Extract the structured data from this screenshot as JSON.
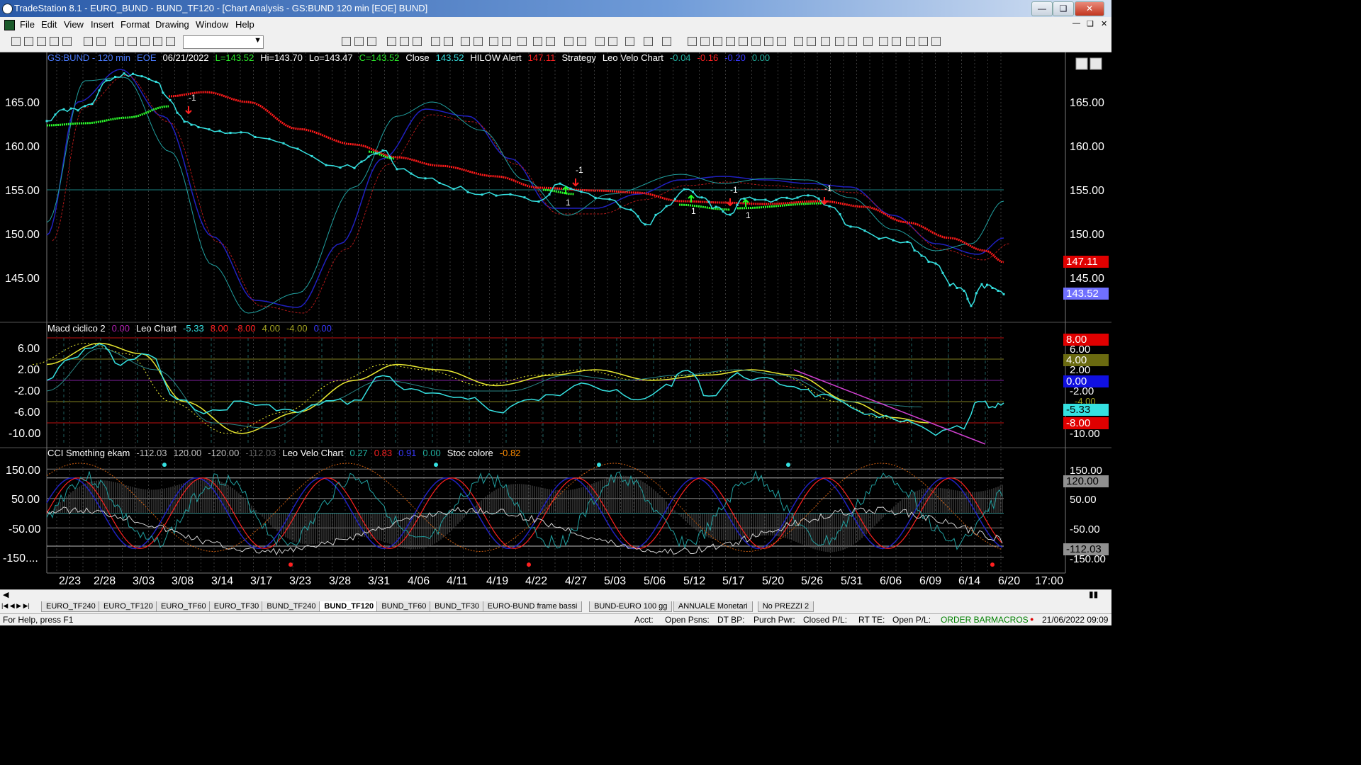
{
  "window": {
    "title": "TradeStation 8.1 - EURO_BUND - BUND_TF120 - [Chart Analysis - GS:BUND  120 min  [EOE] BUND]"
  },
  "menu": [
    "File",
    "Edit",
    "View",
    "Insert",
    "Format",
    "Drawing",
    "Window",
    "Help"
  ],
  "price_panel": {
    "header": [
      {
        "t": "GS:BUND - 120 min",
        "c": "#4a7bff"
      },
      {
        "t": "EOE",
        "c": "#4a7bff"
      },
      {
        "t": "06/21/2022",
        "c": "#ffffff"
      },
      {
        "t": "L=143.52",
        "c": "#29e629"
      },
      {
        "t": "Hi=143.70",
        "c": "#ffffff"
      },
      {
        "t": "Lo=143.47",
        "c": "#ffffff"
      },
      {
        "t": "C=143.52",
        "c": "#29e629"
      },
      {
        "t": "Close",
        "c": "#ffffff"
      },
      {
        "t": "143.52",
        "c": "#35e0e0"
      },
      {
        "t": "HILOW Alert",
        "c": "#ffffff"
      },
      {
        "t": "147.11",
        "c": "#ff2020"
      },
      {
        "t": "Strategy",
        "c": "#ffffff"
      },
      {
        "t": "Leo Velo Chart",
        "c": "#ffffff"
      },
      {
        "t": "-0.04",
        "c": "#20b0a0"
      },
      {
        "t": "-0.16",
        "c": "#ff2020"
      },
      {
        "t": "-0.20",
        "c": "#3838ff"
      },
      {
        "t": "0.00",
        "c": "#20b0a0"
      }
    ],
    "y_ticks": [
      "165.00",
      "160.00",
      "155.00",
      "150.00",
      "145.00"
    ],
    "last_red": "147.11",
    "last_close": "143.52",
    "signals": [
      "-1",
      "-1",
      "1",
      "-1",
      "1",
      "1",
      "-1"
    ]
  },
  "macd_panel": {
    "header": [
      {
        "t": "Macd ciclico 2",
        "c": "#ffffff"
      },
      {
        "t": "0.00",
        "c": "#b020b0"
      },
      {
        "t": "Leo Chart",
        "c": "#ffffff"
      },
      {
        "t": "-5.33",
        "c": "#35e0e0"
      },
      {
        "t": "8.00",
        "c": "#ff2020"
      },
      {
        "t": "-8.00",
        "c": "#ff2020"
      },
      {
        "t": "4.00",
        "c": "#a0a020"
      },
      {
        "t": "-4.00",
        "c": "#a0a020"
      },
      {
        "t": "0.00",
        "c": "#3838ff"
      }
    ],
    "y_ticks": [
      "6.00",
      "2.00",
      "-2.00",
      "-6.00",
      "-10.00"
    ],
    "right_labels": [
      "8.00",
      "6.00",
      "4.00",
      "2.00",
      "0.00",
      "-2.00",
      "-4.00",
      "-5.33",
      "-8.00",
      "-10.00"
    ]
  },
  "cci_panel": {
    "header": [
      {
        "t": "CCI Smothing ekam",
        "c": "#ffffff"
      },
      {
        "t": "-112.03",
        "c": "#c0c0c0"
      },
      {
        "t": "120.00",
        "c": "#c0c0c0"
      },
      {
        "t": "-120.00",
        "c": "#c0c0c0"
      },
      {
        "t": "-112.03",
        "c": "#606060"
      },
      {
        "t": "Leo Velo Chart",
        "c": "#ffffff"
      },
      {
        "t": "0.27",
        "c": "#20b0a0"
      },
      {
        "t": "0.83",
        "c": "#ff2020"
      },
      {
        "t": "0.91",
        "c": "#3838ff"
      },
      {
        "t": "0.00",
        "c": "#20b0a0"
      },
      {
        "t": "Stoc colore",
        "c": "#ffffff"
      },
      {
        "t": "-0.82",
        "c": "#ff8c00"
      }
    ],
    "y_ticks": [
      "150.00",
      "50.00",
      "-50.00",
      "-150...."
    ],
    "right_labels": [
      "150.00",
      "120.00",
      "50.00",
      "-50.00",
      "-112.03",
      "-150.00"
    ]
  },
  "x_axis": [
    "2/23",
    "2/28",
    "3/03",
    "3/08",
    "3/14",
    "3/17",
    "3/23",
    "3/28",
    "3/31",
    "4/06",
    "4/11",
    "4/19",
    "4/22",
    "4/27",
    "5/03",
    "5/06",
    "5/12",
    "5/17",
    "5/20",
    "5/26",
    "5/31",
    "6/06",
    "6/09",
    "6/14",
    "6/20",
    "17:00"
  ],
  "tabs": [
    "EURO_TF240",
    "EURO_TF120",
    "EURO_TF60",
    "EURO_TF30",
    "BUND_TF240",
    "BUND_TF120",
    "BUND_TF60",
    "BUND_TF30",
    "EURO-BUND frame bassi",
    "BUND-EURO 100 gg",
    "ANNUALE Monetari",
    "No PREZZI 2"
  ],
  "active_tab": "BUND_TF120",
  "status": {
    "help": "For Help, press F1",
    "acct": "Acct:",
    "open_psns": "Open Psns:",
    "dt_bp": "DT BP:",
    "purch_pwr": "Purch Pwr:",
    "closed_pl": "Closed P/L:",
    "rt_te": "RT TE:",
    "open_pl": "Open P/L:",
    "order_bar": "ORDER BAR",
    "macros": "MACROS",
    "datetime": "21/06/2022 09:09"
  },
  "colors": {
    "price": "#35e0e0",
    "red_line": "#ff1a1a",
    "green_line": "#2cff2c",
    "navy": "#2020c0",
    "dark_red": "#b01818",
    "yellow": "#e8e830",
    "teal": "#20a0a0"
  }
}
